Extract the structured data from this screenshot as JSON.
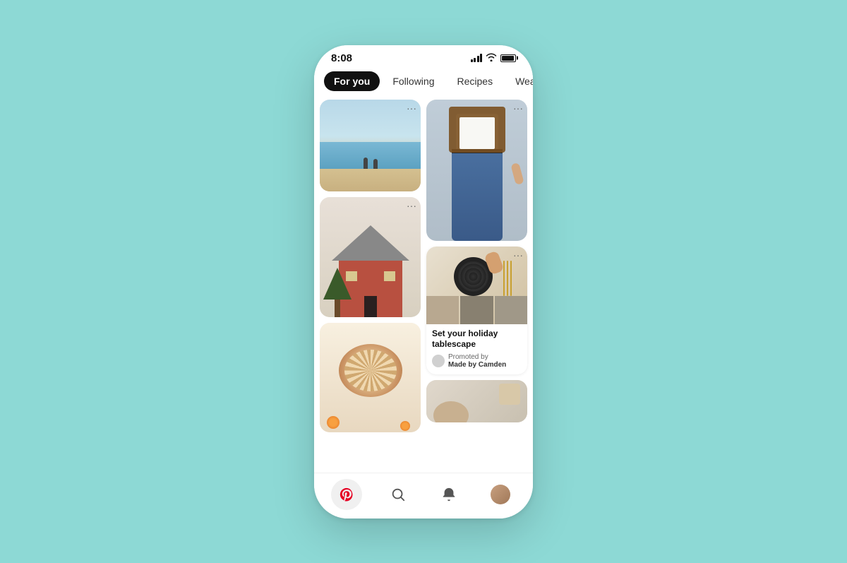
{
  "statusBar": {
    "time": "8:08"
  },
  "tabs": [
    {
      "id": "for-you",
      "label": "For you",
      "active": true
    },
    {
      "id": "following",
      "label": "Following",
      "active": false
    },
    {
      "id": "recipes",
      "label": "Recipes",
      "active": false
    },
    {
      "id": "wear",
      "label": "Wear",
      "active": false
    }
  ],
  "promotedCard": {
    "title": "Set your holiday tablescape",
    "promotedBy": "Promoted by",
    "brand": "Made by Camden"
  },
  "bottomNav": [
    {
      "id": "home",
      "icon": "pinterest",
      "label": "Home"
    },
    {
      "id": "search",
      "icon": "search",
      "label": "Search"
    },
    {
      "id": "notifications",
      "icon": "bell",
      "label": "Notifications"
    },
    {
      "id": "profile",
      "icon": "profile",
      "label": "Profile"
    }
  ]
}
